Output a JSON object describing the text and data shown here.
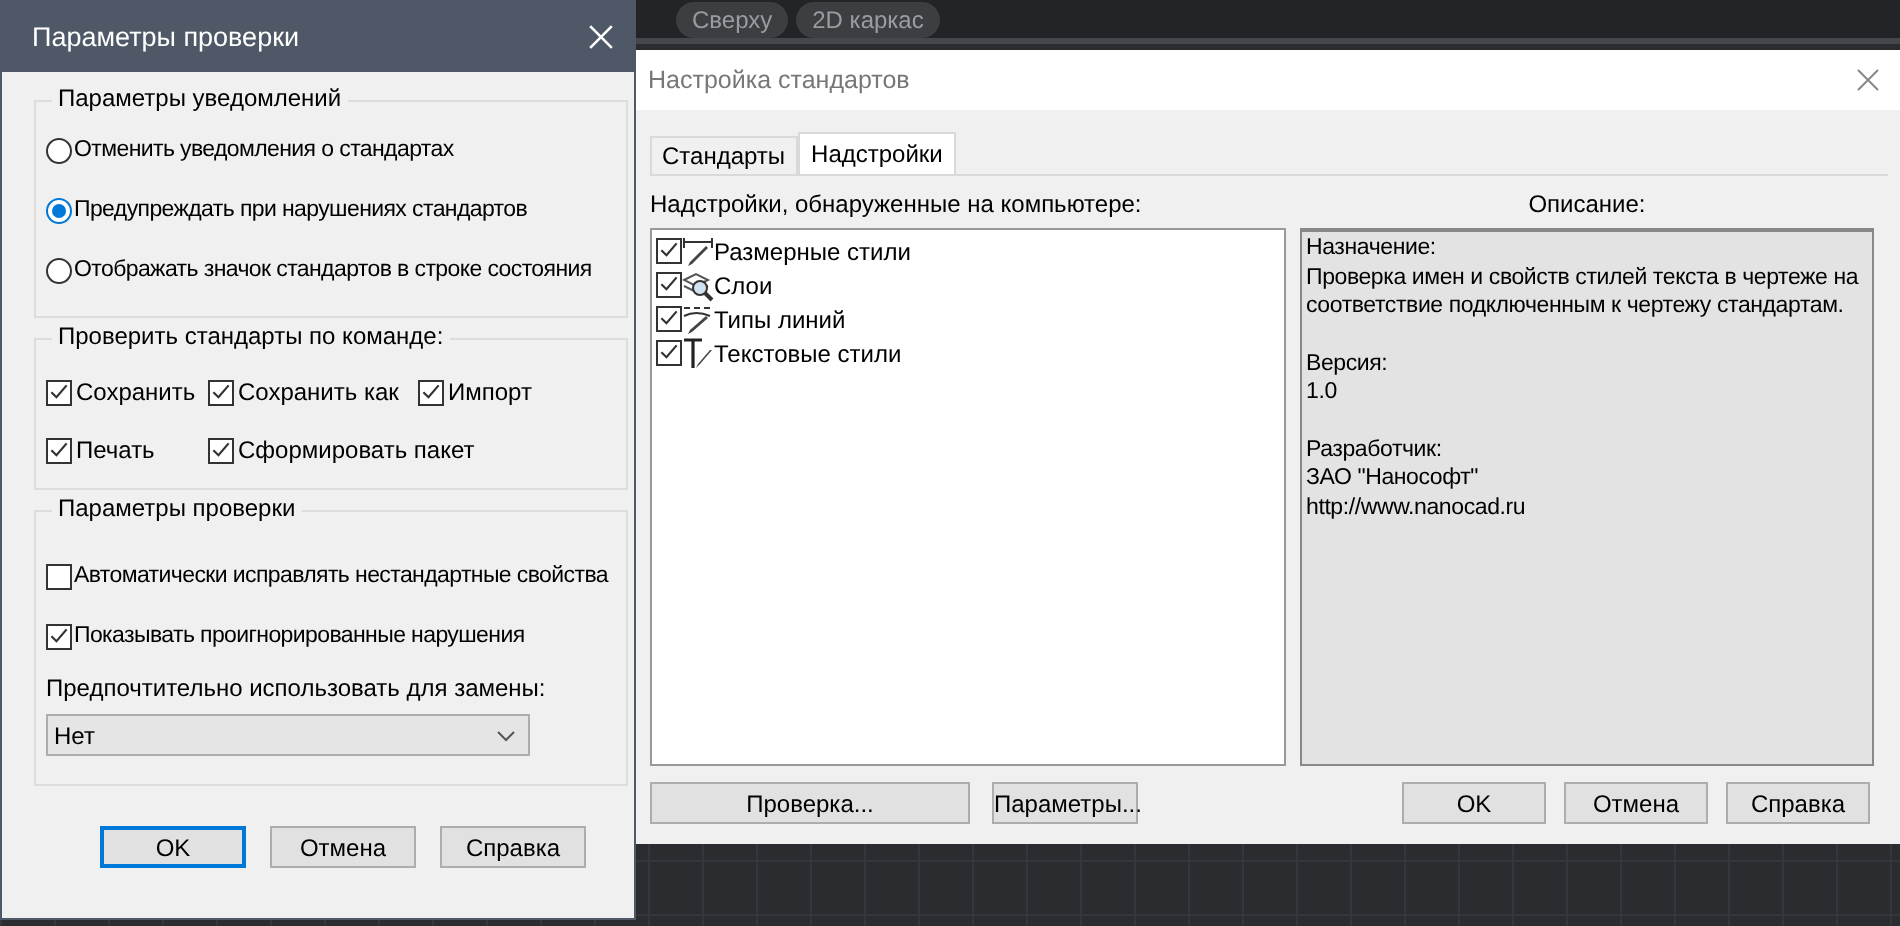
{
  "view_toolbar": {
    "buttons": [
      "Сверху",
      "2D каркас"
    ]
  },
  "standards_window": {
    "title": "Настройка стандартов",
    "tabs": [
      {
        "label": "Стандарты",
        "selected": false
      },
      {
        "label": "Надстройки",
        "selected": true
      }
    ],
    "addins_label": "Надстройки, обнаруженные на компьютере:",
    "addins": [
      {
        "label": "Размерные стили",
        "checked": true,
        "kind": "dimension"
      },
      {
        "label": "Слои",
        "checked": true,
        "kind": "layers"
      },
      {
        "label": "Типы линий",
        "checked": true,
        "kind": "linetype"
      },
      {
        "label": "Текстовые стили",
        "checked": true,
        "kind": "text"
      }
    ],
    "description_label": "Описание:",
    "description": [
      {
        "heading": "Назначение:",
        "lines": [
          "Проверка имен и свойств стилей текста в чертеже на соответствие подключенным к чертежу стандартам."
        ]
      },
      {
        "heading": "Версия:",
        "lines": [
          "1.0"
        ]
      },
      {
        "heading": "Разработчик:",
        "lines": [
          "ЗАО \"Нанософт\"",
          "http://www.nanocad.ru"
        ]
      }
    ],
    "left_buttons": [
      "Проверка...",
      "Параметры..."
    ],
    "buttons": [
      "OK",
      "Отмена",
      "Справка"
    ]
  },
  "check_settings_dialog": {
    "title": "Параметры проверки",
    "notifications": {
      "title": "Параметры уведомлений",
      "options": [
        {
          "label": "Отменить уведомления о стандартах",
          "selected": false
        },
        {
          "label": "Предупреждать при нарушениях стандартов",
          "selected": true
        },
        {
          "label": "Отображать значок стандартов в строке состояния",
          "selected": false
        }
      ]
    },
    "check_on_command": {
      "title": "Проверить стандарты по команде:",
      "items": [
        {
          "label": "Сохранить",
          "checked": true
        },
        {
          "label": "Сохранить как",
          "checked": true
        },
        {
          "label": "Импорт",
          "checked": true
        },
        {
          "label": "Печать",
          "checked": true
        },
        {
          "label": "Сформировать пакет",
          "checked": true
        }
      ]
    },
    "check_params": {
      "title": "Параметры проверки",
      "options": [
        {
          "label": "Автоматически исправлять нестандартные свойства",
          "checked": false
        },
        {
          "label": "Показывать проигнорированные нарушения",
          "checked": true
        }
      ],
      "replace_label": "Предпочтительно использовать для замены:",
      "replace_select": {
        "value": "Нет"
      }
    },
    "buttons": [
      {
        "label": "OK",
        "default": true
      },
      {
        "label": "Отмена",
        "default": false
      },
      {
        "label": "Справка",
        "default": false
      }
    ]
  }
}
